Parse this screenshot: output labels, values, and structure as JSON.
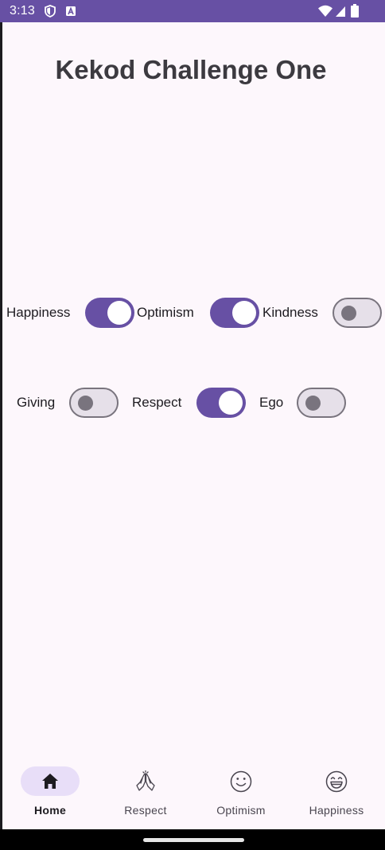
{
  "status_bar": {
    "time": "3:13",
    "left_icons": [
      "shield-icon",
      "a-square-icon"
    ],
    "right_icons": [
      "wifi-icon",
      "signal-icon",
      "battery-icon"
    ],
    "background": "#6750a4"
  },
  "page": {
    "title": "Kekod Challenge One",
    "background": "#fdf7fc"
  },
  "switch_rows": [
    [
      {
        "label": "Happiness",
        "checked": true
      },
      {
        "label": "Optimism",
        "checked": true
      },
      {
        "label": "Kindness",
        "checked": false
      }
    ],
    [
      {
        "label": "Giving",
        "checked": false
      },
      {
        "label": "Respect",
        "checked": true
      },
      {
        "label": "Ego",
        "checked": false
      }
    ]
  ],
  "bottom_nav": {
    "items": [
      {
        "label": "Home",
        "icon": "home-icon",
        "active": true
      },
      {
        "label": "Respect",
        "icon": "praying-hands-icon",
        "active": false
      },
      {
        "label": "Optimism",
        "icon": "smile-icon",
        "active": false
      },
      {
        "label": "Happiness",
        "icon": "grin-icon",
        "active": false
      }
    ]
  },
  "colors": {
    "accent": "#6750a4",
    "nav_indicator": "#e8def8",
    "switch_off_track": "#e6e0e9",
    "switch_off_outline": "#79747e"
  }
}
